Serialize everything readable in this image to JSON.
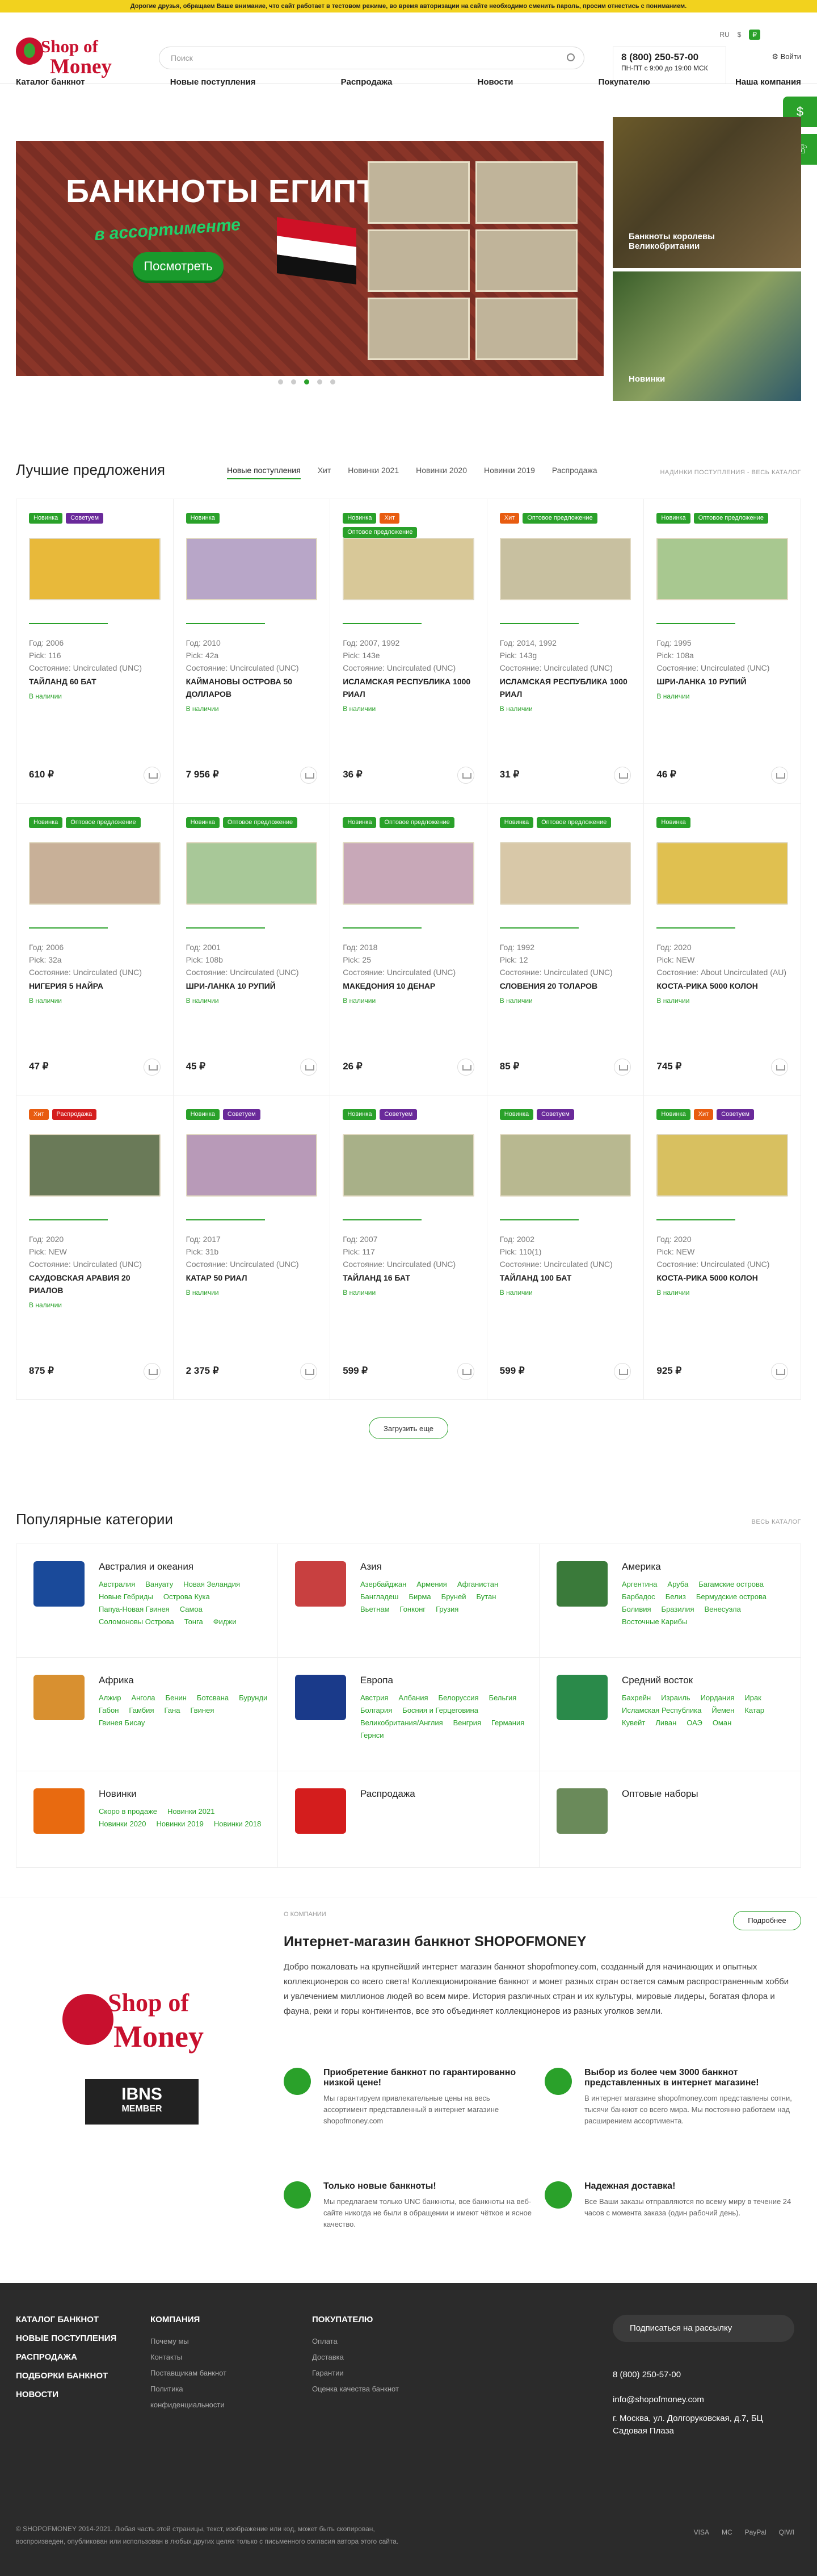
{
  "notice": "Дорогие друзья, обращаем Ваше внимание, что сайт работает в тестовом режиме, во время авторизации на сайте необходимо сменить пароль, просим отнестись с пониманием.",
  "logo": {
    "top": "Shop of",
    "bottom": "Money"
  },
  "search": {
    "placeholder": "Поиск"
  },
  "topbar": {
    "lang": "RU",
    "currency": "$",
    "badge": "₽"
  },
  "contact": {
    "phone": "8 (800) 250-57-00",
    "hours": "ПН-ПТ с 9:00 до 19:00 МСК"
  },
  "user": {
    "label": "Войти"
  },
  "nav": [
    "Каталог банкнот",
    "Новые поступления",
    "Распродажа",
    "Новости",
    "Покупателю",
    "Наша компания"
  ],
  "side_tabs": [
    "$",
    "☏"
  ],
  "hero": {
    "title": "БАНКНОТЫ ЕГИПТА",
    "subtitle": "в ассортименте",
    "button": "Посмотреть"
  },
  "tiles": [
    "Банкноты королевы Великобритании",
    "Новинки"
  ],
  "best": {
    "title": "Лучшие предложения",
    "tabs": [
      "Новые поступления",
      "Хит",
      "Новинки 2021",
      "Новинки 2020",
      "Новинки 2019",
      "Распродажа"
    ],
    "all": "НАДИНКИ ПОСТУПЛЕНИЯ - ВЕСЬ КАТАЛОГ"
  },
  "products": [
    {
      "labels": [
        "Новинка",
        "Советуем"
      ],
      "year": "Год: 2006",
      "pick": "Pick: 116",
      "state": "Состояние: Uncirculated (UNC)",
      "name": "ТАЙЛАНД 60 БАТ",
      "stock": "В наличии",
      "price": "610 ₽"
    },
    {
      "labels": [
        "Новинка"
      ],
      "year": "Год: 2010",
      "pick": "Pick: 42a",
      "state": "Состояние: Uncirculated (UNC)",
      "name": "КАЙМАНОВЫ ОСТРОВА 50 ДОЛЛАРОВ",
      "stock": "В наличии",
      "price": "7 956 ₽"
    },
    {
      "labels": [
        "Новинка",
        "Хит",
        "Оптовое предложение"
      ],
      "year": "Год: 2007, 1992",
      "pick": "Pick: 143e",
      "state": "Состояние: Uncirculated (UNC)",
      "name": "ИСЛАМСКАЯ РЕСПУБЛИКА 1000 РИАЛ",
      "stock": "В наличии",
      "price": "36 ₽"
    },
    {
      "labels": [
        "Хит",
        "Оптовое предложение"
      ],
      "year": "Год: 2014, 1992",
      "pick": "Pick: 143g",
      "state": "Состояние: Uncirculated (UNC)",
      "name": "ИСЛАМСКАЯ РЕСПУБЛИКА 1000 РИАЛ",
      "stock": "В наличии",
      "price": "31 ₽"
    },
    {
      "labels": [
        "Новинка",
        "Оптовое предложение"
      ],
      "year": "Год: 1995",
      "pick": "Pick: 108a",
      "state": "Состояние: Uncirculated (UNC)",
      "name": "ШРИ-ЛАНКА 10 РУПИЙ",
      "stock": "В наличии",
      "price": "46 ₽"
    },
    {
      "labels": [
        "Новинка",
        "Оптовое предложение"
      ],
      "year": "Год: 2006",
      "pick": "Pick: 32a",
      "state": "Состояние: Uncirculated (UNC)",
      "name": "НИГЕРИЯ 5 НАЙРА",
      "stock": "В наличии",
      "price": "47 ₽"
    },
    {
      "labels": [
        "Новинка",
        "Оптовое предложение"
      ],
      "year": "Год: 2001",
      "pick": "Pick: 108b",
      "state": "Состояние: Uncirculated (UNC)",
      "name": "ШРИ-ЛАНКА 10 РУПИЙ",
      "stock": "В наличии",
      "price": "45 ₽"
    },
    {
      "labels": [
        "Новинка",
        "Оптовое предложение"
      ],
      "year": "Год: 2018",
      "pick": "Pick: 25",
      "state": "Состояние: Uncirculated (UNC)",
      "name": "МАКЕДОНИЯ 10 ДЕНАР",
      "stock": "В наличии",
      "price": "26 ₽"
    },
    {
      "labels": [
        "Новинка",
        "Оптовое предложение"
      ],
      "year": "Год: 1992",
      "pick": "Pick: 12",
      "state": "Состояние: Uncirculated (UNC)",
      "name": "СЛОВЕНИЯ 20 ТОЛАРОВ",
      "stock": "В наличии",
      "price": "85 ₽"
    },
    {
      "labels": [
        "Новинка"
      ],
      "year": "Год: 2020",
      "pick": "Pick: NEW",
      "state": "Состояние: About Uncirculated (AU)",
      "name": "КОСТА-РИКА 5000 КОЛОН",
      "stock": "В наличии",
      "price": "745 ₽"
    },
    {
      "labels": [
        "Хит",
        "Распродажа"
      ],
      "year": "Год: 2020",
      "pick": "Pick: NEW",
      "state": "Состояние: Uncirculated (UNC)",
      "name": "САУДОВСКАЯ АРАВИЯ 20 РИАЛОВ",
      "stock": "В наличии",
      "price": "875 ₽"
    },
    {
      "labels": [
        "Новинка",
        "Советуем"
      ],
      "year": "Год: 2017",
      "pick": "Pick: 31b",
      "state": "Состояние: Uncirculated (UNC)",
      "name": "КАТАР 50 РИАЛ",
      "stock": "В наличии",
      "price": "2 375 ₽"
    },
    {
      "labels": [
        "Новинка",
        "Советуем"
      ],
      "year": "Год: 2007",
      "pick": "Pick: 117",
      "state": "Состояние: Uncirculated (UNC)",
      "name": "ТАЙЛАНД 16 БАТ",
      "stock": "В наличии",
      "price": "599 ₽"
    },
    {
      "labels": [
        "Новинка",
        "Советуем"
      ],
      "year": "Год: 2002",
      "pick": "Pick: 110(1)",
      "state": "Состояние: Uncirculated (UNC)",
      "name": "ТАЙЛАНД 100 БАТ",
      "stock": "В наличии",
      "price": "599 ₽"
    },
    {
      "labels": [
        "Новинка",
        "Хит",
        "Советуем"
      ],
      "year": "Год: 2020",
      "pick": "Pick: NEW",
      "state": "Состояние: Uncirculated (UNC)",
      "name": "КОСТА-РИКА 5000 КОЛОН",
      "stock": "В наличии",
      "price": "925 ₽"
    }
  ],
  "more_button": "Загрузить еще",
  "popular": {
    "title": "Популярные категории",
    "all": "ВЕСЬ КАТАЛОГ"
  },
  "categories": [
    {
      "name": "Австралия и океания",
      "links": [
        "Австралия",
        "Вануату",
        "Новая Зеландия",
        "Новые Гебриды",
        "Острова Кука",
        "Папуа-Новая Гвинея",
        "Самоа",
        "Соломоновы Острова",
        "Тонга",
        "Фиджи"
      ]
    },
    {
      "name": "Азия",
      "links": [
        "Азербайджан",
        "Армения",
        "Афганистан",
        "Бангладеш",
        "Бирма",
        "Бруней",
        "Бутан",
        "Вьетнам",
        "Гонконг",
        "Грузия"
      ]
    },
    {
      "name": "Америка",
      "links": [
        "Аргентина",
        "Аруба",
        "Багамские острова",
        "Барбадос",
        "Белиз",
        "Бермудские острова",
        "Боливия",
        "Бразилия",
        "Венесуэла",
        "Восточные Карибы"
      ]
    },
    {
      "name": "Африка",
      "links": [
        "Алжир",
        "Ангола",
        "Бенин",
        "Ботсвана",
        "Бурунди",
        "Габон",
        "Гамбия",
        "Гана",
        "Гвинея",
        "Гвинея Бисау"
      ]
    },
    {
      "name": "Европа",
      "links": [
        "Австрия",
        "Албания",
        "Белоруссия",
        "Бельгия",
        "Болгария",
        "Босния и Герцеговина",
        "Великобритания/Англия",
        "Венгрия",
        "Германия",
        "Гернси"
      ]
    },
    {
      "name": "Средний восток",
      "links": [
        "Бахрейн",
        "Израиль",
        "Иордания",
        "Ирак",
        "Исламская Республика",
        "Йемен",
        "Катар",
        "Кувейт",
        "Ливан",
        "ОАЭ",
        "Оман"
      ]
    },
    {
      "name": "Новинки",
      "links": [
        "Скоро в продаже",
        "Новинки 2021",
        "Новинки 2020",
        "Новинки 2019",
        "Новинки 2018"
      ]
    },
    {
      "name": "Распродажа",
      "links": []
    },
    {
      "name": "Оптовые наборы",
      "links": []
    }
  ],
  "about": {
    "small": "О КОМПАНИИ",
    "title": "Интернет-магазин банкнот SHOPOFMONEY",
    "detail": "Подробнее",
    "ibns": "IBNS",
    "member": "MEMBER",
    "text": "Добро пожаловать на крупнейший интернет магазин банкнот shopofmoney.com, созданный для начинающих и опытных коллекционеров со всего света! Коллекционирование банкнот и монет разных стран остается самым распространенным хобби и увлечением миллионов людей во всем мире. История различных стран и их культуры, мировые лидеры, богатая флора и фауна, реки и горы континентов, все это объединяет коллекционеров из разных уголков земли.",
    "features": [
      {
        "title": "Приобретение банкнот по гарантированно низкой цене!",
        "text": "Мы гарантируем привлекательные цены на весь ассортимент представленный в интернет магазине shopofmoney.com"
      },
      {
        "title": "Выбор из более чем 3000 банкнот представленных в интернет магазине!",
        "text": "В интернет магазине shopofmoney.com представлены сотни, тысячи банкнот со всего мира. Мы постоянно работаем над расширением ассортимента."
      },
      {
        "title": "Только новые банкноты!",
        "text": "Мы предлагаем только UNC банкноты, все банкноты на веб-сайте никогда не были в обращении и имеют чёткое и ясное качество."
      },
      {
        "title": "Надежная доставка!",
        "text": "Все Ваши заказы отправляются по всему миру в течение 24 часов с момента заказа (один рабочий день)."
      }
    ]
  },
  "footer": {
    "col1": [
      "КАТАЛОГ БАНКНОТ",
      "НОВЫЕ ПОСТУПЛЕНИЯ",
      "РАСПРОДАЖА",
      "ПОДБОРКИ БАНКНОТ",
      "НОВОСТИ"
    ],
    "col2_title": "КОМПАНИЯ",
    "col2": [
      "Почему мы",
      "Контакты",
      "Поставщикам банкнот",
      "Политика конфиденциальности"
    ],
    "col3_title": "ПОКУПАТЕЛЮ",
    "col3": [
      "Оплата",
      "Доставка",
      "Гарантии",
      "Оценка качества банкнот"
    ],
    "subscribe": "Подписаться на рассылку",
    "phone": "8 (800) 250-57-00",
    "email": "info@shopofmoney.com",
    "address": "г. Москва, ул. Долгоруковская, д.7, БЦ Садовая Плаза",
    "copyright": "© SHOPOFMONEY 2014-2021. Любая часть этой страницы, текст, изображение или код, может быть скопирован, воспроизведен, опубликован или использован в любых других целях только с письменного согласия автора этого сайта.",
    "payments": [
      "VISA",
      "MC",
      "PayPal",
      "QIWI"
    ]
  }
}
